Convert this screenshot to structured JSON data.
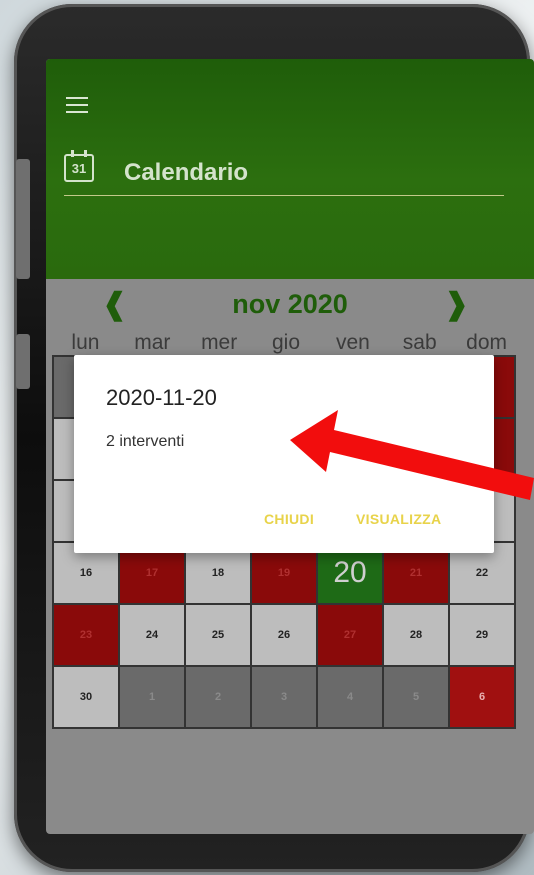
{
  "header": {
    "title": "Calendario",
    "icon_day": "31"
  },
  "nav": {
    "month": "nov 2020",
    "prev": "❰",
    "next": "❱"
  },
  "weekdays": [
    "lun",
    "mar",
    "mer",
    "gio",
    "ven",
    "sab",
    "dom"
  ],
  "calendar_rows": [
    [
      {
        "d": "",
        "t": "dark"
      },
      {
        "d": "",
        "t": "light"
      },
      {
        "d": "",
        "t": "light"
      },
      {
        "d": "",
        "t": "light"
      },
      {
        "d": "",
        "t": "light"
      },
      {
        "d": "",
        "t": "light"
      },
      {
        "d": "",
        "t": "red"
      }
    ],
    [
      {
        "d": "",
        "t": "light"
      },
      {
        "d": "",
        "t": "light"
      },
      {
        "d": "",
        "t": "light"
      },
      {
        "d": "",
        "t": "light"
      },
      {
        "d": "",
        "t": "light"
      },
      {
        "d": "",
        "t": "light"
      },
      {
        "d": "",
        "t": "red"
      }
    ],
    [
      {
        "d": "",
        "t": "light"
      },
      {
        "d": "",
        "t": "light"
      },
      {
        "d": "",
        "t": "light"
      },
      {
        "d": "",
        "t": "light"
      },
      {
        "d": "",
        "t": "light"
      },
      {
        "d": "",
        "t": "light"
      },
      {
        "d": "",
        "t": "light"
      }
    ],
    [
      {
        "d": "16",
        "t": "light"
      },
      {
        "d": "17",
        "t": "red"
      },
      {
        "d": "18",
        "t": "light"
      },
      {
        "d": "19",
        "t": "red"
      },
      {
        "d": "20",
        "t": "today"
      },
      {
        "d": "21",
        "t": "red"
      },
      {
        "d": "22",
        "t": "light"
      }
    ],
    [
      {
        "d": "23",
        "t": "red"
      },
      {
        "d": "24",
        "t": "light"
      },
      {
        "d": "25",
        "t": "light"
      },
      {
        "d": "26",
        "t": "light"
      },
      {
        "d": "27",
        "t": "red"
      },
      {
        "d": "28",
        "t": "light"
      },
      {
        "d": "29",
        "t": "light"
      }
    ],
    [
      {
        "d": "30",
        "t": "light"
      },
      {
        "d": "1",
        "t": "dark"
      },
      {
        "d": "2",
        "t": "dark"
      },
      {
        "d": "3",
        "t": "dark"
      },
      {
        "d": "4",
        "t": "dark"
      },
      {
        "d": "5",
        "t": "dark"
      },
      {
        "d": "6",
        "t": "redbright"
      }
    ]
  ],
  "dialog": {
    "title": "2020-11-20",
    "message": "2 interventi",
    "close_label": "CHIUDI",
    "view_label": "VISUALIZZA"
  },
  "colors": {
    "header_green": "#1f5d0a",
    "red_day": "#8a0a0a",
    "accent_yellow": "#e8d34a"
  }
}
